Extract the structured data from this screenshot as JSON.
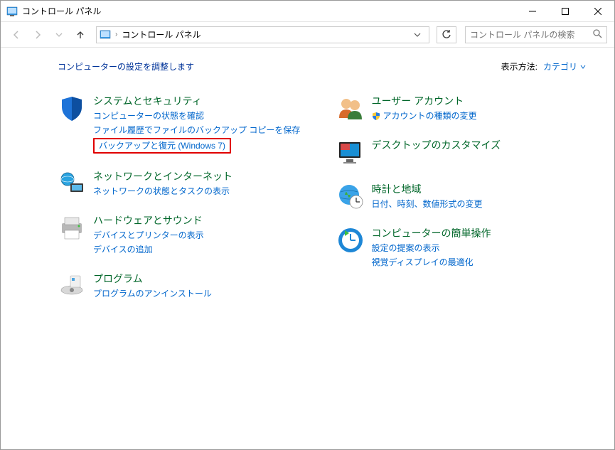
{
  "window": {
    "title": "コントロール パネル"
  },
  "addressbar": {
    "location": "コントロール パネル"
  },
  "search": {
    "placeholder": "コントロール パネルの検索"
  },
  "heading": "コンピューターの設定を調整します",
  "viewby": {
    "label": "表示方法:",
    "value": "カテゴリ"
  },
  "left": {
    "system": {
      "title": "システムとセキュリティ",
      "link1": "コンピューターの状態を確認",
      "link2": "ファイル履歴でファイルのバックアップ コピーを保存",
      "link3": "バックアップと復元 (Windows 7)"
    },
    "network": {
      "title": "ネットワークとインターネット",
      "link1": "ネットワークの状態とタスクの表示"
    },
    "hardware": {
      "title": "ハードウェアとサウンド",
      "link1": "デバイスとプリンターの表示",
      "link2": "デバイスの追加"
    },
    "programs": {
      "title": "プログラム",
      "link1": "プログラムのアンインストール"
    }
  },
  "right": {
    "users": {
      "title": "ユーザー アカウント",
      "link1": "アカウントの種類の変更"
    },
    "desktop": {
      "title": "デスクトップのカスタマイズ"
    },
    "clock": {
      "title": "時計と地域",
      "link1": "日付、時刻、数値形式の変更"
    },
    "ease": {
      "title": "コンピューターの簡単操作",
      "link1": "設定の提案の表示",
      "link2": "視覚ディスプレイの最適化"
    }
  }
}
